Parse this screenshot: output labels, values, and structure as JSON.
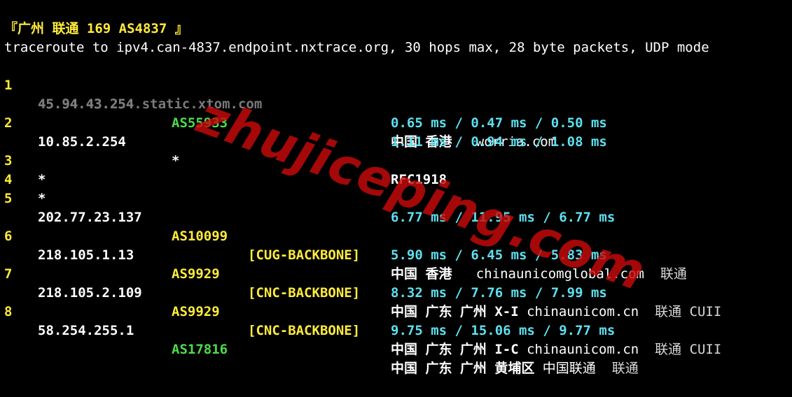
{
  "header": "『广州 联通 169 AS4837 』",
  "command": "traceroute to ipv4.can-4837.endpoint.nxtrace.org, 30 hops max, 28 byte packets, UDP mode",
  "watermark": "zhujiceping.com",
  "colors": {
    "background": "#000000",
    "hop_number": "#ffeb3b",
    "as_green": "#4cdb4c",
    "backbone_tag": "#ffeb3b",
    "rtt": "#5ee0f0",
    "hostname_gray": "#7a7a7a",
    "watermark": "#c80a0a"
  },
  "hops": [
    {
      "num": "1",
      "ip": "45.94.43.254",
      "as": "AS55933",
      "tag": "",
      "geo": "中国 香港",
      "domain": "worria.com",
      "isp": "",
      "hostname": "45.94.43.254.static.xtom.com",
      "rtt": "0.65 ms / 0.47 ms / 0.50 ms"
    },
    {
      "num": "2",
      "ip": "10.85.2.254",
      "as": "*",
      "tag": "",
      "geo": "RFC1918",
      "domain": "",
      "isp": "",
      "hostname": "",
      "rtt": "1.11 ms / 0.94 ms / 1.08 ms"
    },
    {
      "num": "3",
      "ip": "*"
    },
    {
      "num": "4",
      "ip": "*"
    },
    {
      "num": "5",
      "ip": "202.77.23.137",
      "as": "AS10099",
      "tag": "[CUG-BACKBONE]",
      "geo": "中国 香港",
      "domain": "chinaunicomglobal.com",
      "isp": "联通",
      "rtt": "6.77 ms / 11.95 ms / 6.77 ms"
    },
    {
      "num": "6",
      "ip": "218.105.1.13",
      "as": "AS9929",
      "tag": "[CNC-BACKBONE]",
      "geo": "中国 广东 广州 X-I",
      "domain": "chinaunicom.cn",
      "isp": "联通 CUII",
      "rtt": "5.90 ms / 6.45 ms / 5.83 ms"
    },
    {
      "num": "7",
      "ip": "218.105.2.109",
      "as": "AS9929",
      "tag": "[CNC-BACKBONE]",
      "geo": "中国 广东 广州 I-C",
      "domain": "chinaunicom.cn",
      "isp": "联通 CUII",
      "rtt": "8.32 ms / 7.76 ms / 7.99 ms"
    },
    {
      "num": "8",
      "ip": "58.254.255.1",
      "as": "AS17816",
      "tag": "",
      "geo": "中国 广东 广州 黄埔区",
      "domain": "中国联通",
      "isp": "联通",
      "rtt": "9.75 ms / 15.06 ms / 9.77 ms"
    }
  ]
}
